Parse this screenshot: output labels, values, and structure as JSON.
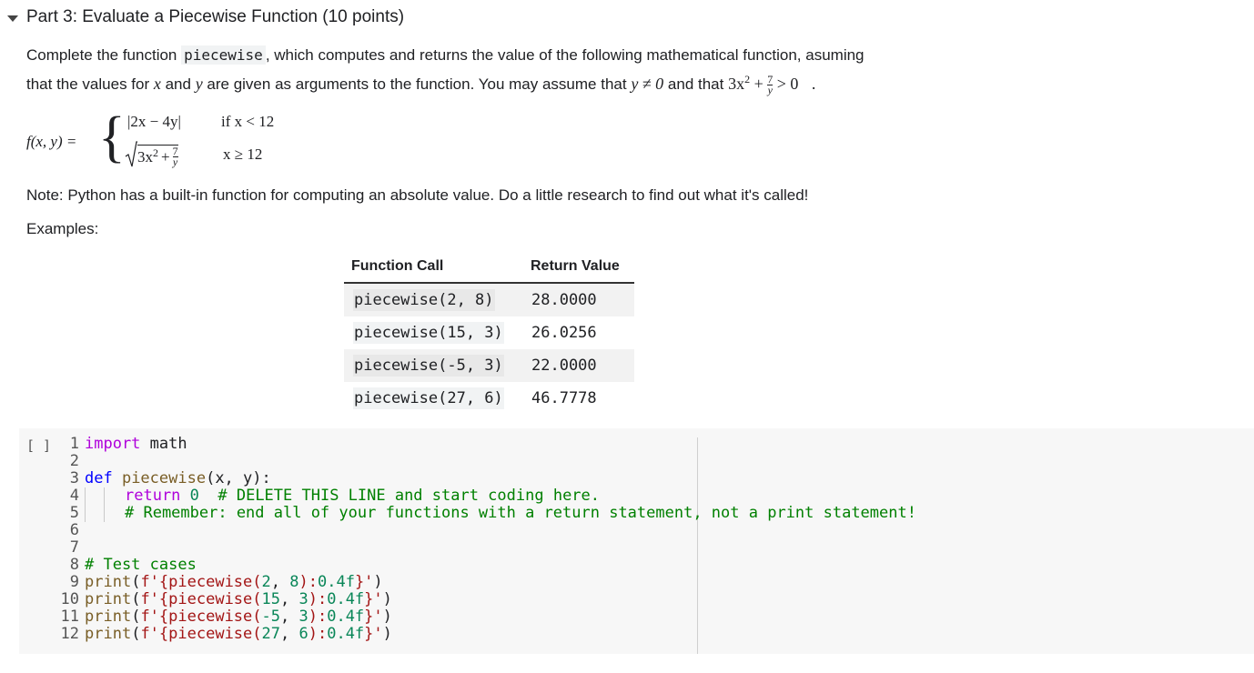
{
  "heading": "Part 3: Evaluate a Piecewise Function (10 points)",
  "intro": {
    "p1_a": "Complete the function ",
    "p1_code": "piecewise",
    "p1_b": ", which computes and returns the value of the following mathematical function, asuming",
    "p2_a": "that the values for ",
    "p2_b": " and ",
    "p2_c": " are given as arguments to the function. You may assume that ",
    "p2_d": " and that "
  },
  "math": {
    "var_x": "x",
    "var_y": "y",
    "y_ne_0": "y ≠ 0",
    "cond_lhs": "3x",
    "cond_rhs": "> 0",
    "fxy": "f(x, y) =",
    "case1_expr": "|2x − 4y|",
    "case1_cond": "if x < 12",
    "case2_expr": "3x",
    "case2_cond": "x ≥ 12",
    "frac_num": "7",
    "frac_den": "y",
    "sq": "2",
    "plus": "+",
    "period": "."
  },
  "note": "Note: Python has a built-in function for computing an absolute value. Do a little research to find out what it's called!",
  "examples_label": "Examples:",
  "table": {
    "col_call": "Function Call",
    "col_return": "Return Value",
    "rows": [
      {
        "call": "piecewise(2, 8)",
        "value": "28.0000"
      },
      {
        "call": "piecewise(15, 3)",
        "value": "26.0256"
      },
      {
        "call": "piecewise(-5, 3)",
        "value": "22.0000"
      },
      {
        "call": "piecewise(27, 6)",
        "value": "46.7778"
      }
    ]
  },
  "cell": {
    "run_label": "[ ]",
    "line_numbers": [
      "1",
      "2",
      "3",
      "4",
      "5",
      "6",
      "7",
      "8",
      "9",
      "10",
      "11",
      "12"
    ],
    "code": {
      "l1_kw": "import",
      "l1_rest": " math",
      "l3_kw": "def",
      "l3_fn": " piecewise",
      "l3_rest": "(x, y):",
      "l4_kw": "return",
      "l4_num": " 0",
      "l4_cm": "  # DELETE THIS LINE and start coding here.",
      "l5_cm": "# Remember: end all of your functions with a return statement, not a print statement!",
      "l8_cm": "# Test cases",
      "test_lines": [
        {
          "a": "print",
          "b": "(",
          "s1": "f'",
          "s2": "{piecewise(",
          "n1": "2",
          "c": ", ",
          "n2": "8",
          "s3": "):",
          "n3": "0.4f",
          "s4": "}'",
          "e": ")"
        },
        {
          "a": "print",
          "b": "(",
          "s1": "f'",
          "s2": "{piecewise(",
          "n1": "15",
          "c": ", ",
          "n2": "3",
          "s3": "):",
          "n3": "0.4f",
          "s4": "}'",
          "e": ")"
        },
        {
          "a": "print",
          "b": "(",
          "s1": "f'",
          "s2": "{piecewise(",
          "n1": "-5",
          "c": ", ",
          "n2": "3",
          "s3": "):",
          "n3": "0.4f",
          "s4": "}'",
          "e": ")"
        },
        {
          "a": "print",
          "b": "(",
          "s1": "f'",
          "s2": "{piecewise(",
          "n1": "27",
          "c": ", ",
          "n2": "6",
          "s3": "):",
          "n3": "0.4f",
          "s4": "}'",
          "e": ")"
        }
      ]
    }
  }
}
